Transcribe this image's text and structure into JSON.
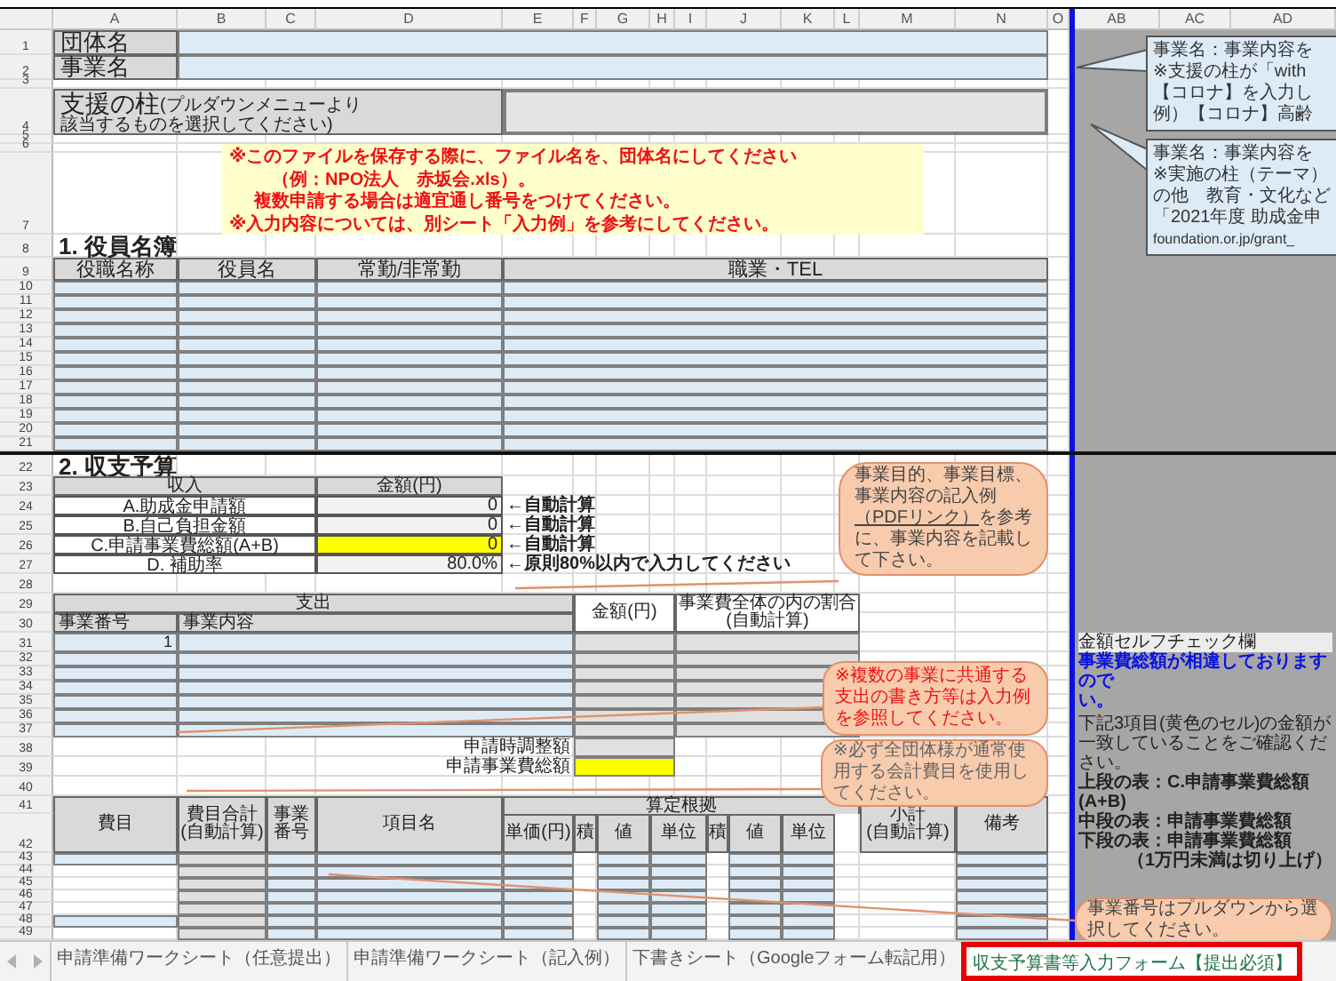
{
  "sheet": {
    "column_headers": [
      "A",
      "B",
      "C",
      "D",
      "E",
      "F",
      "G",
      "H",
      "I",
      "J",
      "K",
      "L",
      "M",
      "N",
      "O",
      "AB",
      "AC",
      "AD"
    ],
    "row_numbers": [
      "1",
      "2",
      "3",
      "4",
      "5",
      "6",
      "7",
      "8",
      "9",
      "10",
      "11",
      "12",
      "13",
      "14",
      "15",
      "16",
      "17",
      "18",
      "19",
      "20",
      "21",
      "22",
      "23",
      "24",
      "25",
      "26",
      "27",
      "28",
      "29",
      "30",
      "31",
      "32",
      "33",
      "34",
      "35",
      "36",
      "37",
      "38",
      "39",
      "40",
      "41",
      "42",
      "43",
      "44",
      "45",
      "46",
      "47",
      "48",
      "49"
    ]
  },
  "org_fields": [
    {
      "label": "団体名"
    },
    {
      "label": "事業名"
    }
  ],
  "pillar": {
    "label": "支援の柱",
    "hint": [
      "(プルダウンメニューより",
      "該当するものを選択してください)"
    ]
  },
  "notice": [
    "※このファイルを保存する際に、ファイル名を、団体名にしてください",
    "（例：NPO法人　赤坂会.xls）。",
    "複数申請する場合は適宜通し番号をつけてください。",
    "※入力内容については、別シート「入力例」を参考にしてください。"
  ],
  "officers": {
    "title": "1. 役員名簿",
    "columns": [
      "役職名称",
      "役員名",
      "常勤/非常勤",
      "職業・TEL"
    ]
  },
  "budget": {
    "title": "2. 収支予算",
    "income_header": "収入",
    "amount_header": "金額(円)",
    "income_rows": [
      {
        "label": "A.助成金申請額",
        "value": "0",
        "note": "←自動計算",
        "highlighted": false
      },
      {
        "label": "B.自己負担金額",
        "value": "0",
        "note": "←自動計算",
        "highlighted": false
      },
      {
        "label": "C.申請事業費総額(A+B)",
        "value": "0",
        "note": "←自動計算",
        "highlighted": true
      },
      {
        "label": "D. 補助率",
        "value": "80.0%",
        "note": "←原則80%以内で入力してください",
        "highlighted": false
      }
    ],
    "expense_header": "支出",
    "expense_columns": [
      "事業番号",
      "事業内容",
      "金額(円)",
      "事業費全体の内の割合(自動計算)"
    ],
    "expense_rows": [
      {
        "number": "1"
      }
    ],
    "adjustments": [
      {
        "label": "申請時調整額",
        "highlighted": false
      },
      {
        "label": "申請事業費総額",
        "highlighted": true
      }
    ]
  },
  "detail": {
    "group_header": "算定根拠",
    "columns": [
      "費目",
      "費目合計(自動計算)",
      "事業番号",
      "項目名",
      "単価(円)",
      "積",
      "値",
      "単位",
      "積",
      "値",
      "単位",
      "小計(自動計算)",
      "備考"
    ]
  },
  "comments": [
    {
      "lines": [
        "事業名：事業内容を",
        "※支援の柱が「with",
        "【コロナ】を入力し",
        "例）【コロナ】高齢"
      ]
    },
    {
      "lines": [
        "事業名：事業内容を",
        "※実施の柱（テーマ）",
        "の他　教育・文化など",
        "「2021年度 助成金申",
        "foundation.or.jp/grant_"
      ]
    }
  ],
  "bubbles": [
    {
      "kind": "link",
      "before": "事業目的、事業目標、事業内容の記入例",
      "link": "（PDFリンク）",
      "after": "を参考に、事業内容を記載して下さい。"
    },
    {
      "kind": "warning",
      "text": "※複数の事業に共通する支出の書き方等は入力例を参照してください。"
    },
    {
      "kind": "note",
      "text": "※必ず全団体様が通常使用する会計費目を使用してください。"
    },
    {
      "kind": "note",
      "text": "事業番号はプルダウンから選択してください。"
    }
  ],
  "self_check": {
    "title": "金額セルフチェック欄",
    "alert": [
      "事業費総額が相違しておりますので",
      "い。"
    ],
    "intro": "下記3項目(黄色のセル)の金額が一致していることをご確認ください。",
    "items": [
      "上段の表：C.申請事業費総額(A+B)",
      "中段の表：申請事業費総額",
      "下段の表：申請事業費総額"
    ],
    "footnote": "（1万円未満は切り上げ）"
  },
  "sheet_tabs": [
    {
      "label": "申請準備ワークシート（任意提出）",
      "selected": false,
      "marked": false
    },
    {
      "label": "申請準備ワークシート（記入例）",
      "selected": false,
      "marked": false
    },
    {
      "label": "下書きシート（Googleフォーム転記用）",
      "selected": false,
      "marked": false
    },
    {
      "label": "収支予算書等入力フォーム【提出必須】",
      "selected": true,
      "marked": true
    }
  ]
}
